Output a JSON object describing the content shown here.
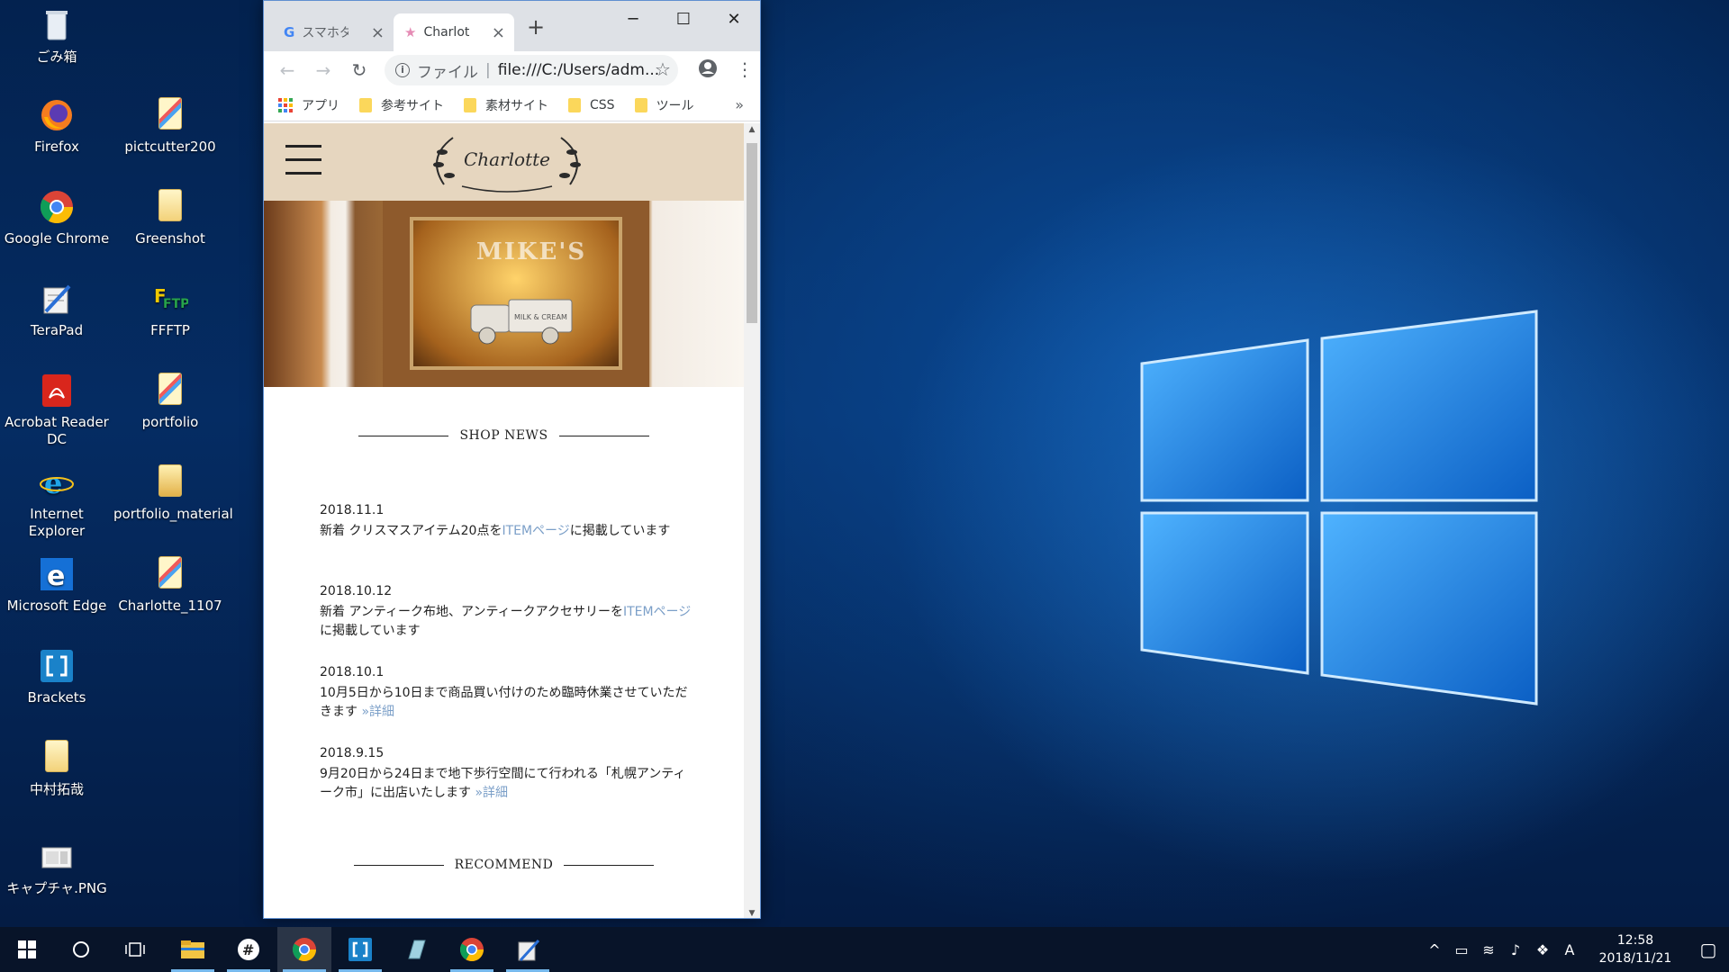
{
  "desktop": {
    "icons": [
      {
        "label": "ごみ箱",
        "icon": "recycle-bin-icon"
      },
      {
        "label": "Firefox",
        "icon": "firefox-icon"
      },
      {
        "label": "pictcutter200",
        "icon": "folder-icon"
      },
      {
        "label": "Google Chrome",
        "icon": "chrome-icon"
      },
      {
        "label": "Greenshot",
        "icon": "folder-icon"
      },
      {
        "label": "TeraPad",
        "icon": "terapad-icon"
      },
      {
        "label": "FFFTP",
        "icon": "ffftp-icon"
      },
      {
        "label": "Acrobat Reader DC",
        "icon": "acrobat-icon"
      },
      {
        "label": "portfolio",
        "icon": "folder-icon"
      },
      {
        "label": "Internet Explorer",
        "icon": "ie-icon"
      },
      {
        "label": "portfolio_material",
        "icon": "folder-icon"
      },
      {
        "label": "Microsoft Edge",
        "icon": "edge-icon"
      },
      {
        "label": "Charlotte_1107",
        "icon": "folder-icon"
      },
      {
        "label": "Brackets",
        "icon": "brackets-icon"
      },
      {
        "label": "中村拓哉",
        "icon": "folder-icon"
      },
      {
        "label": "キャプチャ.PNG",
        "icon": "image-file-icon"
      }
    ]
  },
  "browser": {
    "tabs": [
      {
        "title": "スマホタ",
        "favicon": "google-icon",
        "active": false
      },
      {
        "title": "Charlot",
        "favicon": "star-icon",
        "active": true
      }
    ],
    "new_tab": "+",
    "window_controls": {
      "minimize": "─",
      "maximize": "☐",
      "close": "✕"
    },
    "address": {
      "scheme_label": "ファイル",
      "separator": "|",
      "url": "file:///C:/Users/adm..."
    },
    "bookmarks": [
      {
        "label": "アプリ",
        "icon": "apps-icon"
      },
      {
        "label": "参考サイト",
        "icon": "folder-icon"
      },
      {
        "label": "素材サイト",
        "icon": "folder-icon"
      },
      {
        "label": "CSS",
        "icon": "folder-icon"
      },
      {
        "label": "ツール",
        "icon": "folder-icon"
      }
    ],
    "bookmarks_more": "»"
  },
  "page": {
    "logo": "Charlotte",
    "hero_sign": "MIKE'S",
    "hero_truck_text": "MILK & CREAM",
    "shop_news_title": "SHOP NEWS",
    "news": [
      {
        "date": "2018.11.1",
        "pre": "新着 クリスマスアイテム20点を",
        "link": "ITEMページ",
        "post": "に掲載しています"
      },
      {
        "date": "2018.10.12",
        "pre": "新着 アンティーク布地、アンティークアクセサリーを",
        "link": "ITEMページ",
        "post": "に掲載しています"
      },
      {
        "date": "2018.10.1",
        "pre": "10月5日から10日まで商品買い付けのため臨時休業させていただきます ",
        "link": "»詳細",
        "post": ""
      },
      {
        "date": "2018.9.15",
        "pre": "9月20日から24日まで地下歩行空間にて行われる「札幌アンティーク市」に出店いたします ",
        "link": "»詳細",
        "post": ""
      }
    ],
    "recommend_title": "RECOMMEND"
  },
  "taskbar": {
    "tray_ime": "A",
    "clock_time": "12:58",
    "clock_date": "2018/11/21"
  },
  "colors": {
    "header_bg": "#e6d6bf",
    "link": "#7b9fc8",
    "taskbar_accent": "#76b9ed"
  }
}
